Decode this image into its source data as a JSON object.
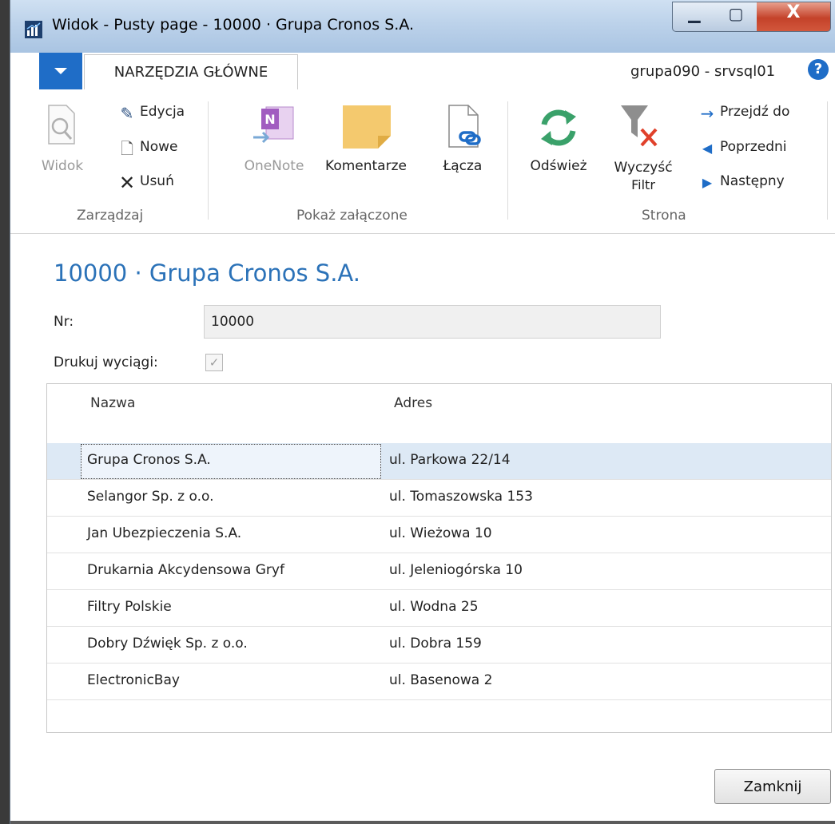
{
  "window": {
    "title": "Widok - Pusty page - 10000 · Grupa Cronos S.A.",
    "minimize_glyph": "▁",
    "maximize_glyph": "▢",
    "close_glyph": "X"
  },
  "tabs": {
    "home_label": "NARZĘDZIA GŁÓWNE",
    "server_label": "grupa090 - srvsql01",
    "help_glyph": "?"
  },
  "ribbon": {
    "groups": {
      "manage": "Zarządzaj",
      "attachments": "Pokaż załączone",
      "page": "Strona"
    },
    "buttons": {
      "view": "Widok",
      "edit": "Edycja",
      "new": "Nowe",
      "delete": "Usuń",
      "onenote": "OneNote",
      "comments": "Komentarze",
      "links": "Łącza",
      "refresh": "Odśwież",
      "clear_filter_line1": "Wyczyść",
      "clear_filter_line2": "Filtr",
      "goto": "Przejdź do",
      "previous": "Poprzedni",
      "next": "Następny"
    }
  },
  "page": {
    "heading": "10000 · Grupa Cronos S.A.",
    "nr_label": "Nr:",
    "nr_value": "10000",
    "print_statements_label": "Drukuj wyciągi:",
    "print_statements_checked": true
  },
  "grid": {
    "columns": [
      "Nazwa",
      "Adres"
    ],
    "rows": [
      {
        "name": "Grupa Cronos S.A.",
        "address": "ul. Parkowa 22/14"
      },
      {
        "name": "Selangor Sp. z o.o.",
        "address": "ul. Tomaszowska 153"
      },
      {
        "name": "Jan Ubezpieczenia S.A.",
        "address": "ul. Wieżowa 10"
      },
      {
        "name": "Drukarnia Akcydensowa Gryf",
        "address": "ul. Jeleniogórska 10"
      },
      {
        "name": "Filtry Polskie",
        "address": "ul. Wodna 25"
      },
      {
        "name": "Dobry Dźwięk Sp. z o.o.",
        "address": "ul. Dobra 159"
      },
      {
        "name": "ElectronicBay",
        "address": "ul. Basenowa 2"
      }
    ]
  },
  "footer": {
    "close_label": "Zamknij"
  },
  "colors": {
    "accent": "#1f6dc7",
    "heading": "#2b72b8",
    "selected_row": "#dde9f5"
  }
}
